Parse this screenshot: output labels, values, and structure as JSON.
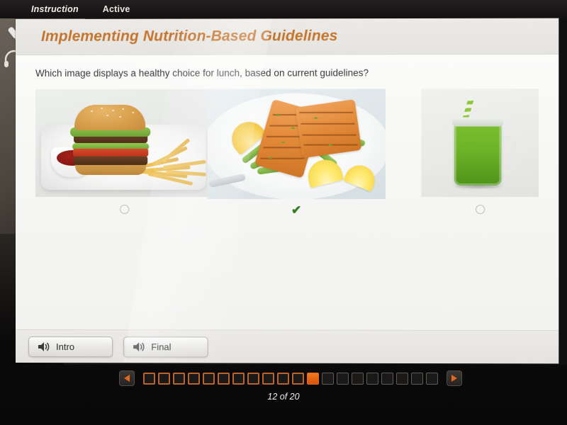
{
  "topbar": {
    "tabs": [
      {
        "label": "Instruction",
        "icon": "instruction-tab"
      },
      {
        "label": "Active",
        "icon": "active-tab"
      }
    ]
  },
  "device_tools": [
    {
      "icon": "pencil-icon",
      "label": "Pencil"
    },
    {
      "icon": "headphones-icon",
      "label": "Headphones"
    }
  ],
  "slide": {
    "title": "Implementing Nutrition-Based Guidelines",
    "title_color": "#c4762f",
    "question": "Which image displays a healthy choice for lunch, based on current guidelines?"
  },
  "options": [
    {
      "id": "option-1",
      "image_description": "hamburger with french fries and ketchup dip on a white plate",
      "selected": false,
      "mark": "radio"
    },
    {
      "id": "option-2",
      "image_description": "grilled salmon fillets with green beans, lemon wedges and herbs on a white plate",
      "selected": true,
      "mark": "check",
      "check_glyph": "✔",
      "check_color": "#2f7d1f"
    },
    {
      "id": "option-3",
      "image_description": "green smoothie in a mason jar with a striped paper straw",
      "selected": false,
      "mark": "radio"
    }
  ],
  "audio_buttons": [
    {
      "label": "Intro",
      "icon": "speaker-icon"
    },
    {
      "label": "Final",
      "icon": "speaker-icon"
    }
  ],
  "navigation": {
    "prev_icon": "arrow-left-icon",
    "next_icon": "arrow-right-icon",
    "current_page": 12,
    "total_pages": 20,
    "counter_text": "12 of 20",
    "accent_color": "#e2661b",
    "pips": [
      "done",
      "done",
      "done",
      "done",
      "done",
      "done",
      "done",
      "done",
      "done",
      "done",
      "done",
      "current",
      "todo",
      "todo",
      "todo",
      "todo",
      "todo",
      "todo",
      "todo",
      "todo"
    ]
  }
}
